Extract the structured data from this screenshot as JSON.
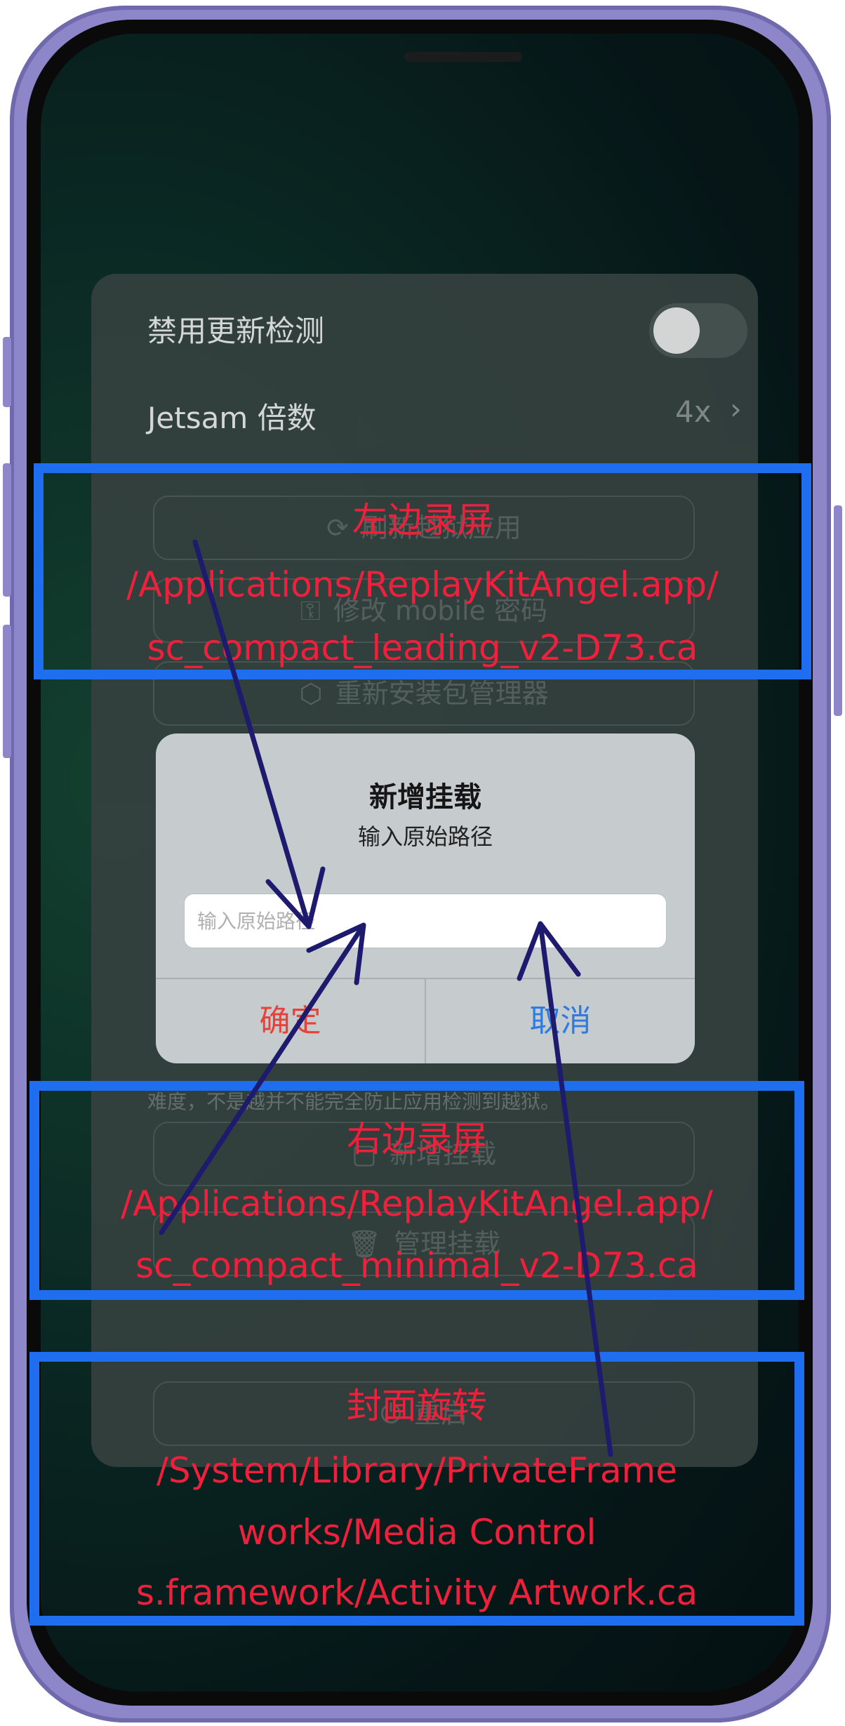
{
  "settings": {
    "toggle_label": "禁用更新检测",
    "jetsam_label": "Jetsam 倍数",
    "jetsam_value": "4x",
    "chevron": "›",
    "refresh_button": "刷新越狱应用",
    "change_password_button": "修改 mobile 密码",
    "reinstall_button": "重新安装包管理器",
    "description_text": "难度，不是越并不能完全防止应用检测到越狱。",
    "add_mount_button": "新增挂载",
    "manage_mount_button": "管理挂载",
    "reboot_button": "重启"
  },
  "dialog": {
    "title": "新增挂载",
    "message": "输入原始路径",
    "input_placeholder": "输入原始路径",
    "confirm_label": "确定",
    "cancel_label": "取消",
    "confirm_color": "#e8413a",
    "cancel_color": "#2f7be0"
  },
  "annotations": {
    "left_record": {
      "title": "左边录屏",
      "line1": "/Applications/ReplayKitAngel.app/",
      "line2": "sc_compact_leading_v2-D73.ca"
    },
    "right_record": {
      "title": "右边录屏",
      "line1": "/Applications/ReplayKitAngel.app/",
      "line2": "sc_compact_minimal_v2-D73.ca"
    },
    "cover_rotation": {
      "title": "封面旋转",
      "line1": "/System/Library/PrivateFrame",
      "line2": "works/Media Control",
      "line3": "s.framework/Activity Artwork.ca"
    },
    "box_color": "#1f6ef0",
    "text_color": "#f0203c",
    "arrow_color": "#1e1a6e"
  }
}
